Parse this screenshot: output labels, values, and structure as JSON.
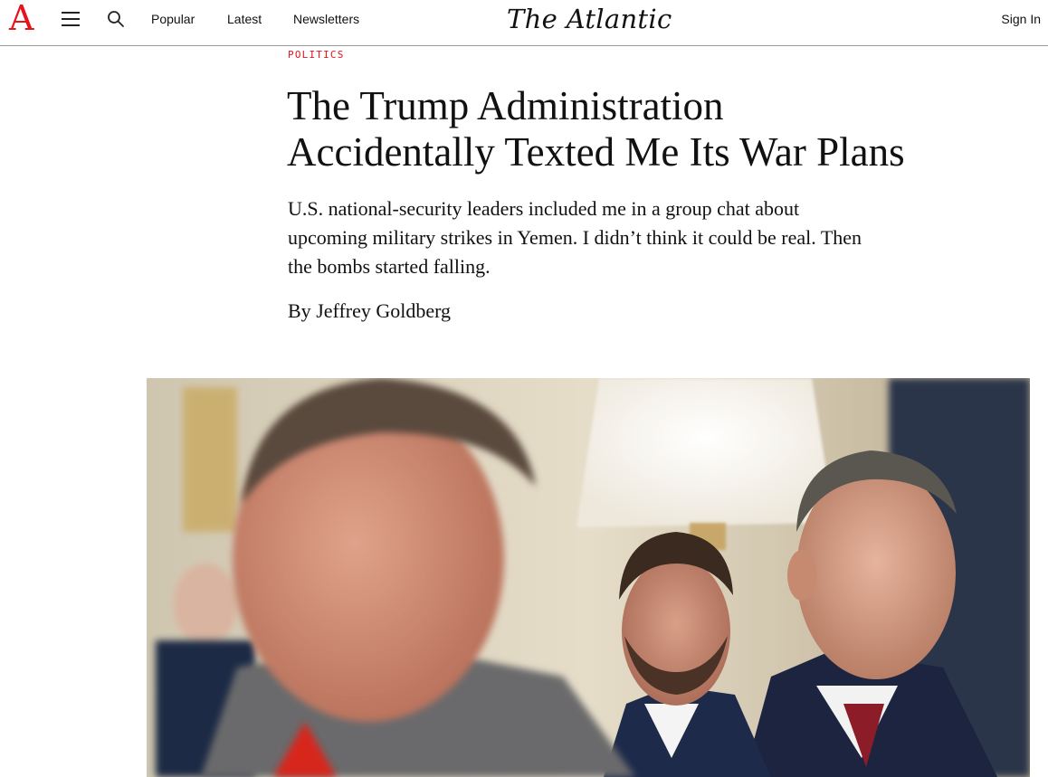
{
  "header": {
    "logo_letter": "A",
    "nav": {
      "popular": "Popular",
      "latest": "Latest",
      "newsletters": "Newsletters"
    },
    "masthead": "The Atlantic",
    "sign_in": "Sign In"
  },
  "article": {
    "section": "POLITICS",
    "headline": "The Trump Administration Accidentally Texted Me Its War Plans",
    "dek": "U.S. national-security leaders included me in a group chat about upcoming military strikes in Yemen. I didn’t think it could be real. Then the bombs started falling.",
    "byline_prefix": "By",
    "author": "Jeffrey Goldberg"
  },
  "colors": {
    "brand_red": "#e7131a",
    "text": "#111111",
    "header_border": "#9a9a9a"
  },
  "icons": {
    "menu": "hamburger-menu-icon",
    "search": "search-icon"
  }
}
